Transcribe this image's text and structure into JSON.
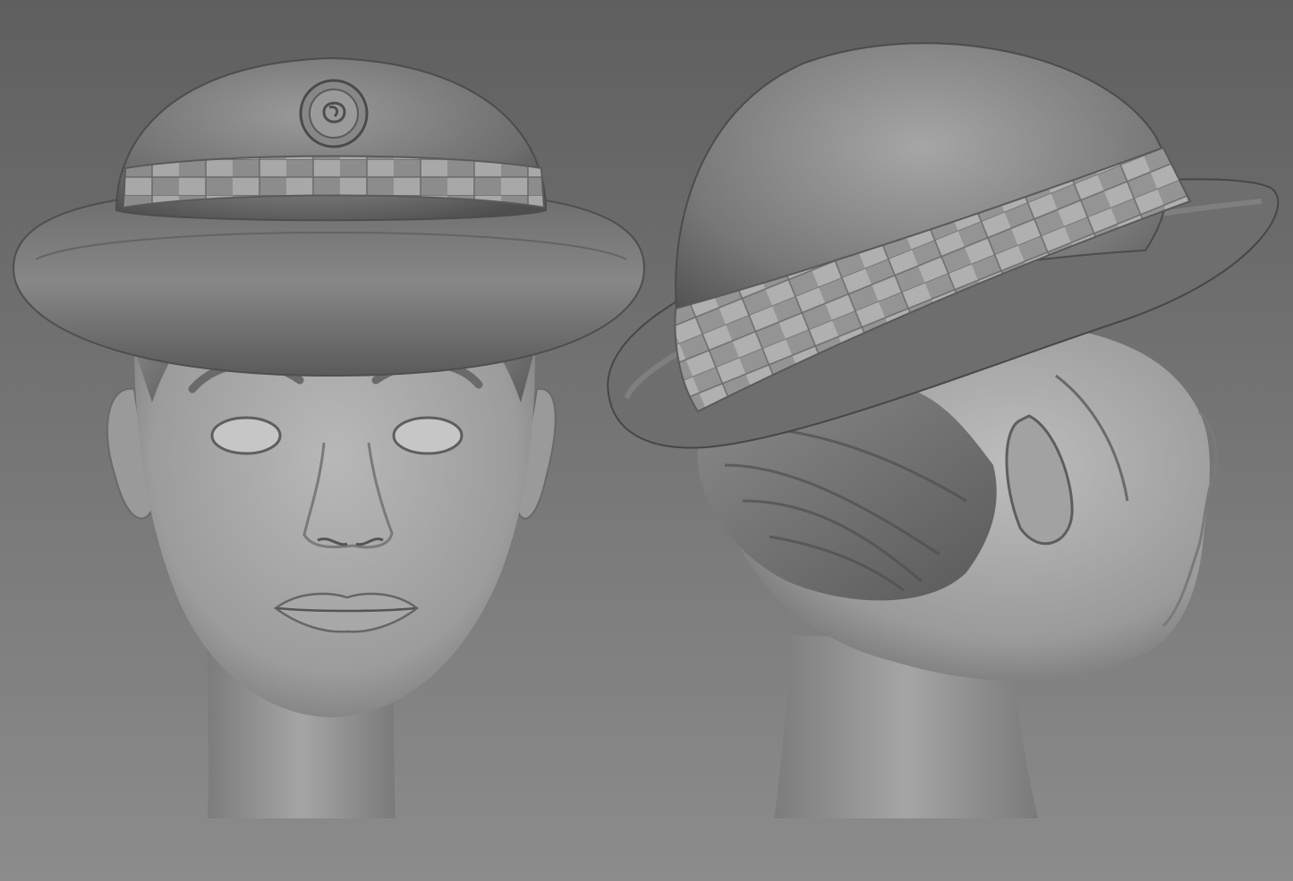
{
  "scene": {
    "colors": {
      "bg_top": "#626262",
      "bg_bottom": "#8a8a8a",
      "clay_light": "#c4c4c4",
      "clay_mid": "#8f8f8f",
      "clay_dark": "#4a4a4a"
    },
    "views": [
      {
        "name": "front-view"
      },
      {
        "name": "side-view"
      }
    ]
  }
}
